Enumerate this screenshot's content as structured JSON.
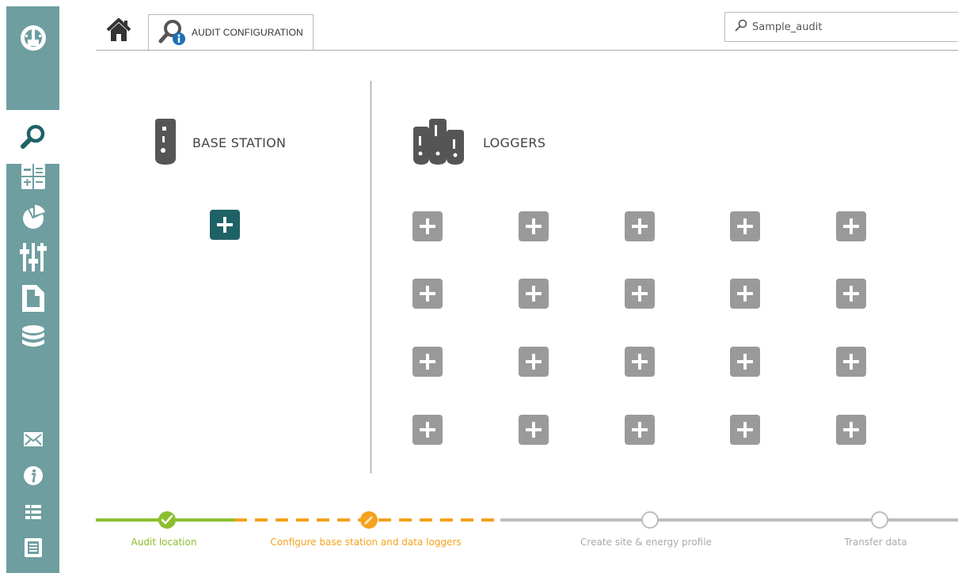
{
  "colors": {
    "sidebar": "#6e9ea0",
    "accent_dark_teal": "#1f6266",
    "step_done": "#8cbf2f",
    "step_active": "#f4a21f",
    "step_todo": "#bdbdbd",
    "add_button": "#9a9a9a"
  },
  "sidebar": {
    "top_icons": [
      "tachometer-icon"
    ],
    "items": [
      {
        "icon": "search-icon",
        "active": true
      },
      {
        "icon": "calculator-icon"
      },
      {
        "icon": "pie-chart-icon"
      },
      {
        "icon": "sliders-icon"
      },
      {
        "icon": "document-icon"
      },
      {
        "icon": "database-icon"
      }
    ],
    "bottom_items": [
      {
        "icon": "envelope-icon"
      },
      {
        "icon": "info-icon"
      },
      {
        "icon": "list-icon"
      },
      {
        "icon": "report-icon"
      }
    ]
  },
  "header": {
    "home_icon": "home-icon",
    "tab_label": "AUDIT CONFIGURATION",
    "tab_icon": "audit-search-info-icon",
    "search_value": "Sample_audit",
    "search_icon": "search-icon"
  },
  "base_station": {
    "title": "BASE STATION",
    "icon": "base-station-icon",
    "add_icon": "plus-icon"
  },
  "loggers": {
    "title": "LOGGERS",
    "icon": "loggers-icon",
    "add_icon": "plus-icon",
    "rows": 4,
    "columns": 5
  },
  "progress": {
    "steps": [
      {
        "label": "Audit location",
        "status": "done"
      },
      {
        "label": "Configure base station and data loggers",
        "status": "active"
      },
      {
        "label": "Create site & energy profile",
        "status": "todo"
      },
      {
        "label": "Transfer data",
        "status": "todo"
      }
    ]
  }
}
